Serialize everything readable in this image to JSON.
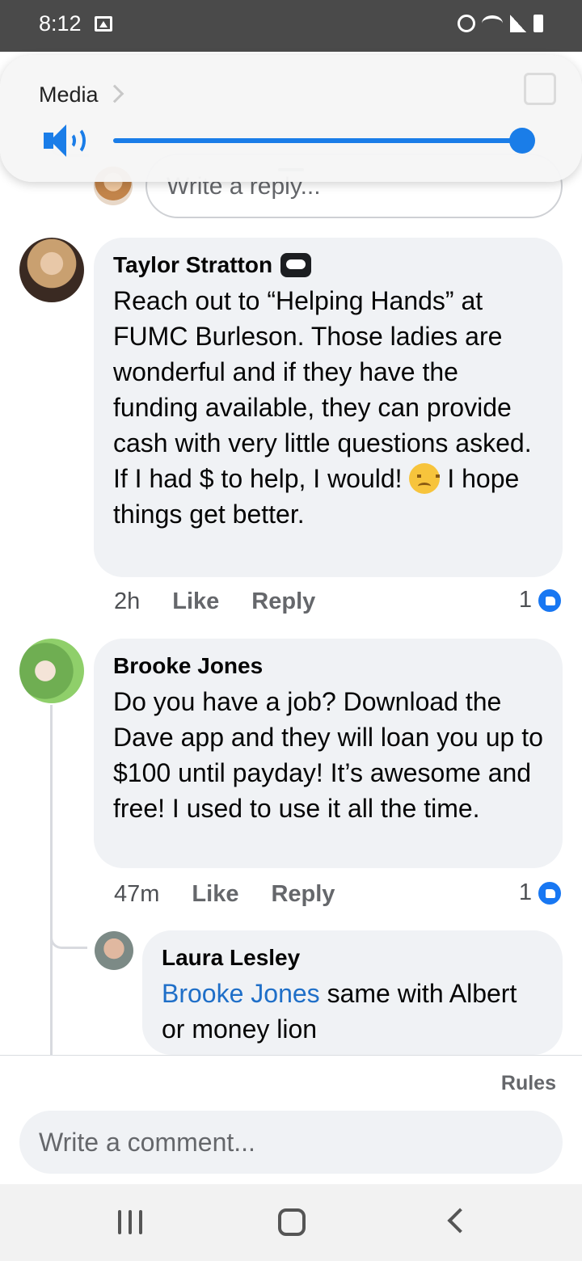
{
  "status_bar": {
    "time": "8:12"
  },
  "volume_panel": {
    "label": "Media",
    "level": 1.0,
    "accent": "#1a7de8"
  },
  "reply_composer": {
    "placeholder": "Write a reply..."
  },
  "comments": [
    {
      "author": "Taylor Stratton",
      "badge_icon": "conversation-starter-icon",
      "text": "Reach out to “Helping Hands” at FUMC Burleson. Those ladies are wonderful and if they have the funding available, they can provide cash with very little questions asked.\nIf I had $ to help, I would! ",
      "emoji": "disappointed-face-emoji",
      "text_after_emoji": " I hope things get better.",
      "time": "2h",
      "like_label": "Like",
      "reply_label": "Reply",
      "reaction_count": "1"
    },
    {
      "author": "Brooke Jones",
      "text": "Do you have a job? Download the Dave app and they will loan you up to $100 until payday! It’s awesome and free! I used to use it all the time.",
      "time": "47m",
      "like_label": "Like",
      "reply_label": "Reply",
      "reaction_count": "1"
    },
    {
      "author": "Laura Lesley",
      "mention": "Brooke Jones",
      "text": " same with Albert or money lion"
    }
  ],
  "footer": {
    "rules_label": "Rules",
    "comment_placeholder": "Write a comment..."
  },
  "colors": {
    "link": "#1f6fc8",
    "like_blue": "#1877f2",
    "bubble": "#f0f2f5"
  }
}
